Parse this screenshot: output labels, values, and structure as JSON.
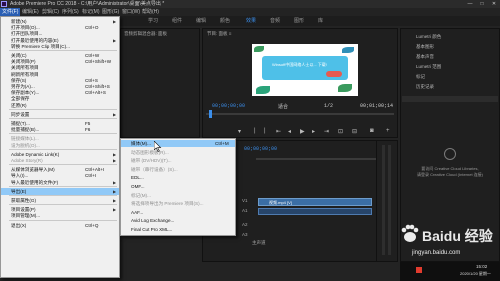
{
  "window": {
    "title": "Adobe Premiere Pro CC 2018 - C:\\用户\\Administrator\\桌面\\美点导出 *",
    "controls": [
      "—",
      "□",
      "✕"
    ]
  },
  "menubar": [
    "文件(F)",
    "编辑(E)",
    "剪辑(C)",
    "序列(S)",
    "标记(M)",
    "图形(G)",
    "窗口(W)",
    "帮助(H)"
  ],
  "workspaces": [
    "学习",
    "组件",
    "编辑",
    "颜色",
    "效果",
    "音频",
    "图形",
    "库"
  ],
  "panels": {
    "source_title": "音频剪辑混合器: 面板",
    "program_title": "节目: 面板 ≡",
    "program_tc_left": "00;00;00;00",
    "program_fit": "适合",
    "program_ratio": "1/2",
    "program_tc_right": "00;01;00;14",
    "video_caption": "Winsoft中国网络人士以... 下载!",
    "timeline_tc": "00;00;00;00"
  },
  "right_panel": {
    "items": [
      "Lumetri 颜色",
      "基本图形",
      "基本声音",
      "Lumetri 范围",
      "标记",
      "历史记录"
    ],
    "cc_lines": [
      "要访问 Creative Cloud Libraries,",
      "请登录 Creative Cloud (Internet 连接)"
    ]
  },
  "timeline": {
    "clip_label": "视频.mp4 [V]",
    "track_labels": [
      "V1",
      "A1",
      "A2",
      "A3",
      "主声道"
    ]
  },
  "file_menu": [
    {
      "label": "新建(N)",
      "sc": "",
      "arrow": true
    },
    {
      "label": "打开项目(O)...",
      "sc": "Ctrl+O"
    },
    {
      "label": "打开团队项目...",
      "sc": ""
    },
    {
      "label": "打开最近使用的内容(E)",
      "sc": "",
      "arrow": true
    },
    {
      "label": "转换 Premiere Clip 项目(C)...",
      "sc": ""
    },
    {
      "sep": true
    },
    {
      "label": "关闭(C)",
      "sc": "Ctrl+W"
    },
    {
      "label": "关闭项目(P)",
      "sc": "Ctrl+Shift+W"
    },
    {
      "label": "关闭所有项目",
      "sc": ""
    },
    {
      "label": "刷新所有项目",
      "sc": ""
    },
    {
      "label": "保存(S)",
      "sc": "Ctrl+S"
    },
    {
      "label": "另存为(A)...",
      "sc": "Ctrl+Shift+S"
    },
    {
      "label": "保存副本(Y)...",
      "sc": "Ctrl+Alt+S"
    },
    {
      "label": "全部保存",
      "sc": ""
    },
    {
      "label": "还原(R)",
      "sc": ""
    },
    {
      "sep": true
    },
    {
      "label": "同步设置",
      "sc": "",
      "arrow": true
    },
    {
      "sep": true
    },
    {
      "label": "捕捉(T)...",
      "sc": "F5"
    },
    {
      "label": "批量捕捉(B)...",
      "sc": "F6"
    },
    {
      "sep": true
    },
    {
      "label": "链接媒体(L)...",
      "sc": "",
      "dis": true
    },
    {
      "label": "设为脱机(O)...",
      "sc": "",
      "dis": true
    },
    {
      "sep": true
    },
    {
      "label": "Adobe Dynamic Link(K)",
      "sc": "",
      "arrow": true
    },
    {
      "label": "Adobe Story(R)",
      "sc": "",
      "dis": true,
      "arrow": true
    },
    {
      "sep": true
    },
    {
      "label": "从媒体浏览器导入(M)",
      "sc": "Ctrl+Alt+I"
    },
    {
      "label": "导入(I)...",
      "sc": "Ctrl+I"
    },
    {
      "label": "导入最近使用的文件(F)",
      "sc": "",
      "arrow": true
    },
    {
      "sep": true
    },
    {
      "label": "导出(E)",
      "sc": "",
      "arrow": true,
      "hl": true
    },
    {
      "sep": true
    },
    {
      "label": "获取属性(G)",
      "sc": "",
      "arrow": true
    },
    {
      "sep": true
    },
    {
      "label": "项目设置(P)",
      "sc": "",
      "arrow": true
    },
    {
      "label": "项目管理(M)...",
      "sc": ""
    },
    {
      "sep": true
    },
    {
      "label": "退出(X)",
      "sc": "Ctrl+Q"
    }
  ],
  "export_menu": [
    {
      "label": "媒体(M)...",
      "sc": "Ctrl+M",
      "hl": true
    },
    {
      "label": "动态图形模板(R)...",
      "dis": true
    },
    {
      "label": "磁带 (DV/HDV)(T)...",
      "dis": true
    },
    {
      "label": "磁带（串行设备）(S)...",
      "dis": true
    },
    {
      "label": "EDL..."
    },
    {
      "label": "OMF..."
    },
    {
      "label": "标记(M)...",
      "dis": true
    },
    {
      "label": "将选择项导出为 Premiere 项目(S)...",
      "dis": true
    },
    {
      "label": "AAF..."
    },
    {
      "label": "Avid Log Exchange..."
    },
    {
      "label": "Final Cut Pro XML..."
    }
  ],
  "watermark": {
    "name": "Baidu 经验",
    "url": "jingyan.baidu.com"
  },
  "taskbar": {
    "time": "15:02",
    "date": "2020/1/20 星期一"
  }
}
